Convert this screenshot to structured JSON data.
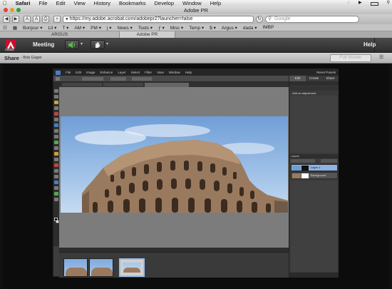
{
  "mac_menubar": {
    "app": "Safari",
    "items": [
      "File",
      "Edit",
      "View",
      "History",
      "Bookmarks",
      "Develop",
      "Window",
      "Help"
    ]
  },
  "window": {
    "title": "Adobe PR"
  },
  "browser_toolbar": {
    "url": "https://my.adobe.acrobat.com/adobepr2?launcher=false",
    "search_placeholder": "Google"
  },
  "bookmarks_bar": {
    "items": [
      "Bonjour ▾",
      "Lit ▾",
      "T ▾",
      "AM ▾",
      "PM ▾",
      "j ▾",
      "News ▾",
      "Tools ▾",
      "ƒ ▾",
      "Misc ▾",
      "Temp ▾",
      "$ ▾",
      "Argus ▾",
      "dada ▾",
      "IMBP"
    ]
  },
  "browser_tabs": [
    {
      "label": "ARGUS"
    },
    {
      "label": "Adobe PR"
    }
  ],
  "connect": {
    "brand": "Adobe",
    "meeting_menu": "Meeting",
    "help_label": "Help"
  },
  "share_pod": {
    "title": "Share",
    "presenter": "- Bob Gager",
    "fullscreen_label": "Full Screen"
  },
  "pse": {
    "menu": [
      "File",
      "Edit",
      "Image",
      "Enhance",
      "Layer",
      "Select",
      "Filter",
      "View",
      "Window",
      "Help"
    ],
    "reset_panels": "Reset Panels",
    "panel_tabs": [
      "Edit",
      "Create",
      "Share"
    ],
    "adjustments_title": "Add an adjustment",
    "layers_title": "Layers",
    "layers": [
      "Layer 1",
      "Background"
    ],
    "colors": {
      "accent": "#4a7fc0",
      "ui": "#3d3d3d"
    }
  },
  "colors": {
    "connect_bar": "#383838",
    "speaker_green": "#56b848",
    "adobe_red": "#c8102e"
  }
}
